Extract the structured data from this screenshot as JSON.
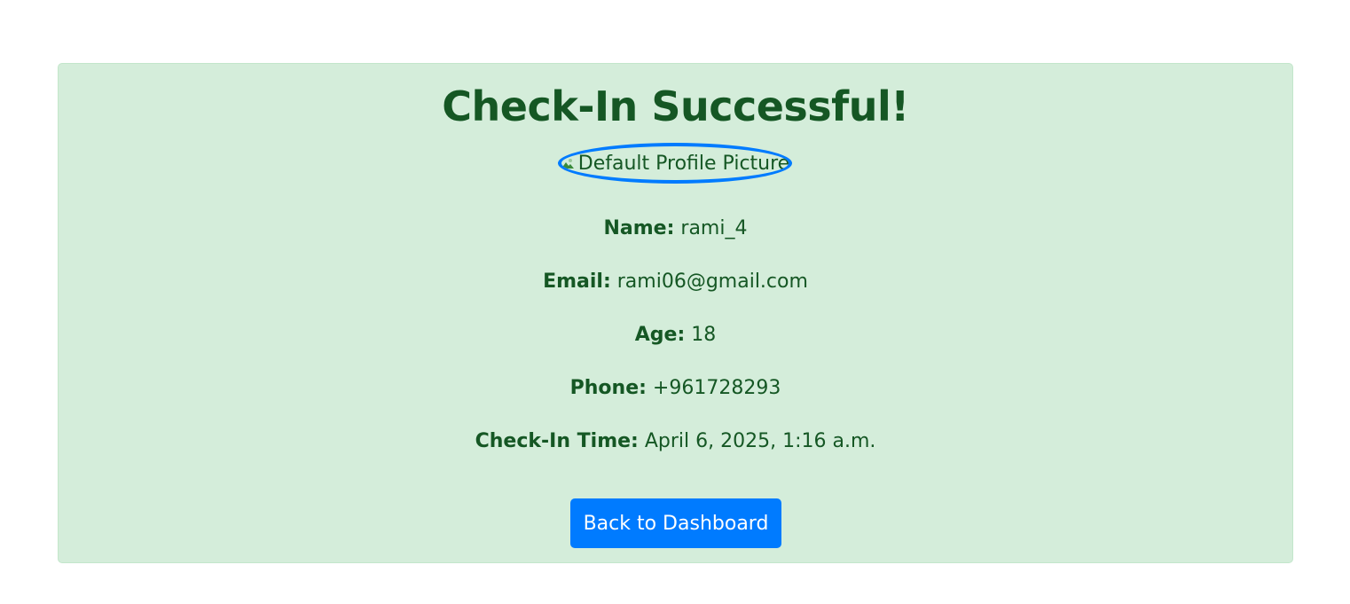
{
  "title": "Check-In Successful!",
  "profile_picture": {
    "alt": "Default Profile Picture",
    "icon": "broken-image-icon"
  },
  "details": [
    {
      "label": "Name:",
      "value": "rami_4"
    },
    {
      "label": "Email:",
      "value": "rami06@gmail.com"
    },
    {
      "label": "Age:",
      "value": "18"
    },
    {
      "label": "Phone:",
      "value": "+961728293"
    },
    {
      "label": "Check-In Time:",
      "value": "April 6, 2025, 1:16 a.m."
    }
  ],
  "back_button_label": "Back to Dashboard",
  "colors": {
    "success_bg": "#d4edda",
    "success_text": "#155724",
    "primary": "#007bff"
  }
}
